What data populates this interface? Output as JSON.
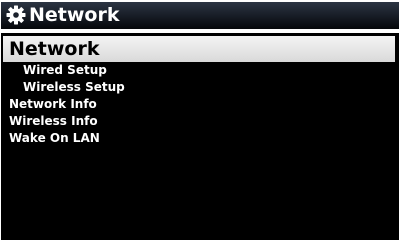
{
  "header": {
    "title": "Network",
    "icon": "gear-icon"
  },
  "menu": {
    "items": [
      {
        "label": "Network",
        "selected": true
      },
      {
        "label": "Wired Setup",
        "indent": 1
      },
      {
        "label": "Wireless Setup",
        "indent": 1
      },
      {
        "label": "Network Info"
      },
      {
        "label": "Wireless Info"
      },
      {
        "label": "Wake On LAN"
      }
    ]
  },
  "colors": {
    "background": "#000000",
    "text": "#ffffff",
    "selected_background": "#e6e6e6",
    "selected_text": "#000000",
    "title_bar": "#1a202b"
  }
}
